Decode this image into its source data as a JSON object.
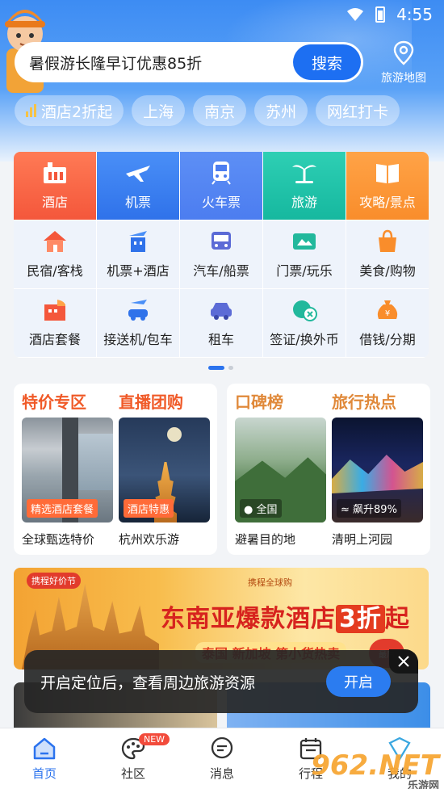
{
  "status_bar": {
    "time": "4:55"
  },
  "search": {
    "text": "暑假游长隆早订优惠85折",
    "button": "搜索"
  },
  "map_entry": {
    "label": "旅游地图",
    "icon": "location-pin-icon"
  },
  "chips": [
    "酒店2折起",
    "上海",
    "南京",
    "苏州",
    "网红打卡"
  ],
  "services": {
    "top": [
      {
        "label": "酒店",
        "icon": "hotel-icon"
      },
      {
        "label": "机票",
        "icon": "plane-icon"
      },
      {
        "label": "火车票",
        "icon": "train-icon"
      },
      {
        "label": "旅游",
        "icon": "palm-tree-icon"
      },
      {
        "label": "攻略/景点",
        "icon": "book-icon"
      }
    ],
    "row2": [
      {
        "label": "民宿/客栈",
        "icon": "house-icon"
      },
      {
        "label": "机票+酒店",
        "icon": "plane-hotel-icon"
      },
      {
        "label": "汽车/船票",
        "icon": "bus-icon"
      },
      {
        "label": "门票/玩乐",
        "icon": "ticket-icon"
      },
      {
        "label": "美食/购物",
        "icon": "shopping-bag-icon"
      }
    ],
    "row3": [
      {
        "label": "酒店套餐",
        "icon": "hotel-package-icon"
      },
      {
        "label": "接送机/包车",
        "icon": "airport-car-icon"
      },
      {
        "label": "租车",
        "icon": "car-icon"
      },
      {
        "label": "签证/换外币",
        "icon": "visa-currency-icon"
      },
      {
        "label": "借钱/分期",
        "icon": "money-bag-icon"
      }
    ]
  },
  "feature_left": {
    "titles": [
      "特价专区",
      "直播团购"
    ],
    "tiles": [
      {
        "tag": "精选酒店套餐",
        "caption": "全球甄选特价"
      },
      {
        "tag": "酒店特惠",
        "caption": "杭州欢乐游"
      }
    ]
  },
  "feature_right": {
    "titles": [
      "口碑榜",
      "旅行热点"
    ],
    "tiles": [
      {
        "tag": "全国",
        "caption": "避暑目的地"
      },
      {
        "tag": "飙升89%",
        "caption": "清明上河园"
      }
    ]
  },
  "banner": {
    "badge": "携程好价节",
    "brand": "携程全球购",
    "headline_prefix": "东南亚爆款酒店",
    "headline_highlight": "3折",
    "headline_suffix": "起",
    "sub": "泰国 新加坡 第小货热卖",
    "seal": "最后"
  },
  "toast": {
    "message": "开启定位后，查看周边旅游资源",
    "button": "开启"
  },
  "tabbar": {
    "items": [
      {
        "label": "首页",
        "icon": "home-icon"
      },
      {
        "label": "社区",
        "icon": "palette-icon"
      },
      {
        "label": "消息",
        "icon": "message-icon"
      },
      {
        "label": "行程",
        "icon": "calendar-icon"
      },
      {
        "label": "我的",
        "icon": "profile-icon"
      }
    ],
    "new_badge": "NEW"
  },
  "watermark": {
    "brand": "962.NET",
    "sub": "乐游网"
  },
  "colors": {
    "primary": "#2b73ee",
    "hotel": "#f4573b",
    "tour": "#16b89f",
    "guide": "#f98d2b"
  }
}
